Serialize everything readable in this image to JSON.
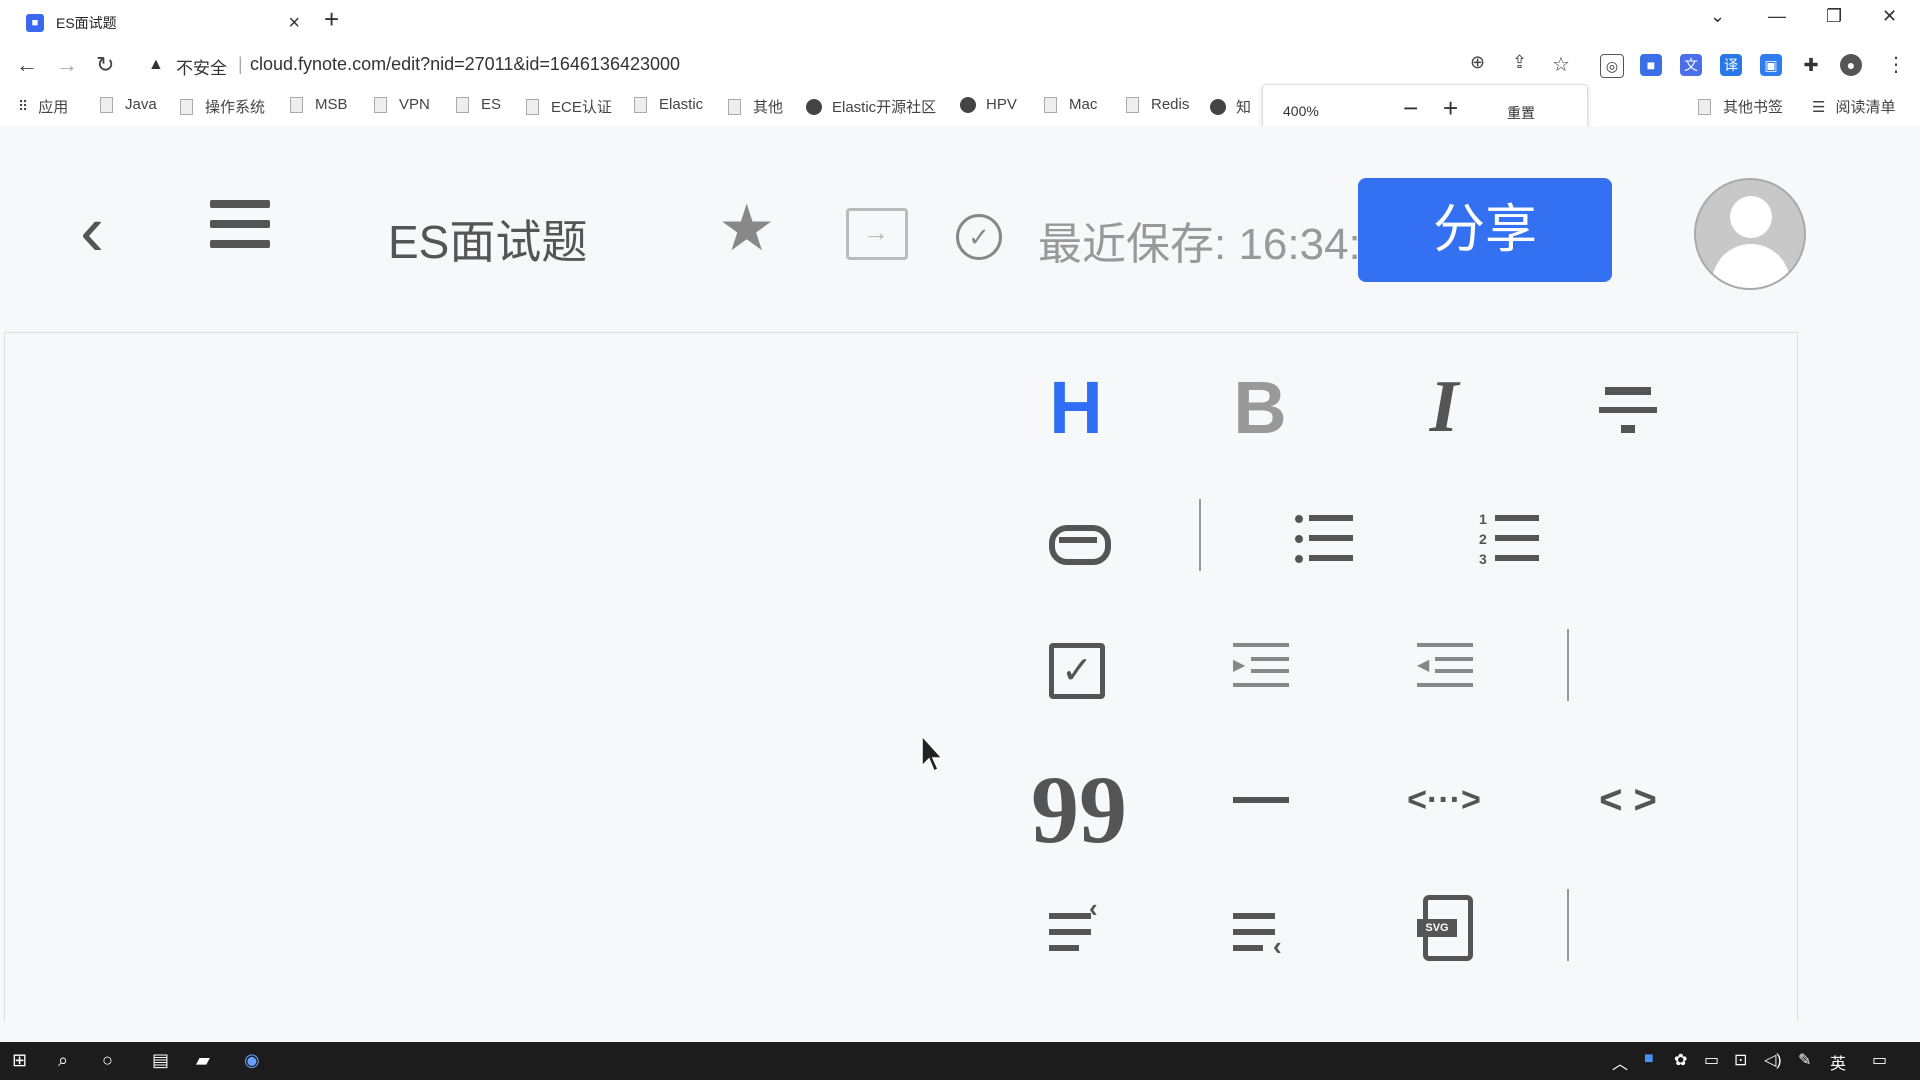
{
  "browser": {
    "tab_title": "ES面试题",
    "url_warning": "不安全",
    "url": "cloud.fynote.com/edit?nid=27011&id=1646136423000",
    "bookmarks": [
      "应用",
      "Java",
      "操作系统",
      "MSB",
      "VPN",
      "ES",
      "ECE认证",
      "Elastic",
      "其他",
      "Elastic开源社区",
      "HPV",
      "Mac",
      "Redis",
      "知"
    ],
    "bookmarks_right": [
      "其他书签",
      "阅读清单"
    ],
    "zoom": {
      "level": "400%",
      "minus": "−",
      "plus": "+",
      "reset": "重置"
    }
  },
  "app": {
    "doc_title": "ES面试题",
    "save_status": "最近保存: 16:34:",
    "share_label": "分享"
  },
  "toolbar": {
    "heading_glyph": "H",
    "bold_glyph": "B",
    "italic_glyph": "I",
    "code_glyph": "< >",
    "inline_code_glyph": "<···>",
    "svg_glyph": "SVG",
    "quote_glyph": "99"
  },
  "taskbar": {
    "ime": "英"
  },
  "colors": {
    "accent": "#3370f2",
    "heading_blue": "#2f6ef5"
  }
}
